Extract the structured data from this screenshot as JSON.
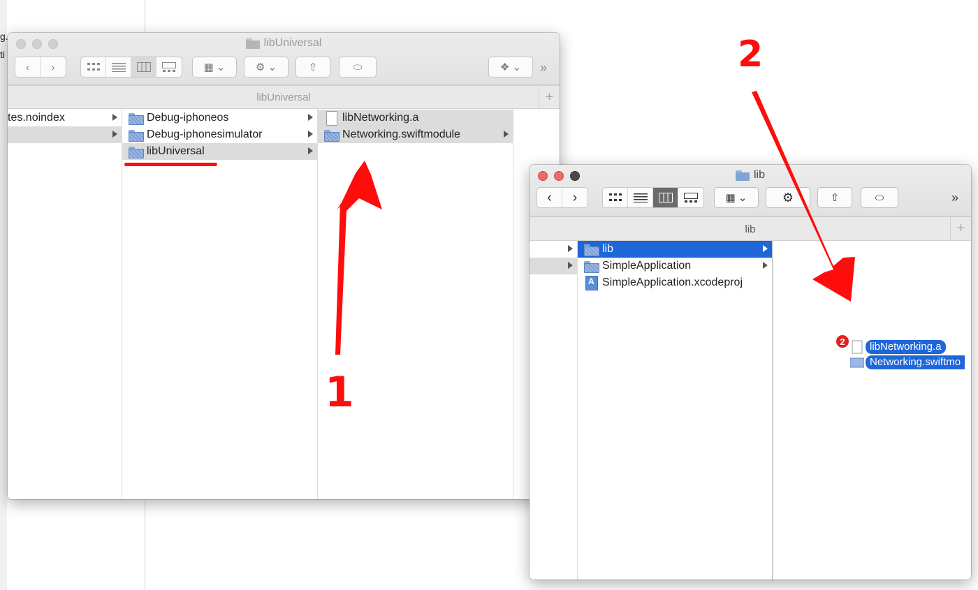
{
  "background_window": {
    "fragments": [
      "g.",
      "ti",
      "tes.noindex"
    ]
  },
  "window1": {
    "title": "libUniversal",
    "path_label": "libUniversal",
    "toolbar": {
      "back_glyph": "‹",
      "forward_glyph": "›",
      "view_icons": [
        "grid-view-icon",
        "list-view-icon",
        "column-view-icon",
        "gallery-view-icon"
      ],
      "group_glyph": "▦ ⌄",
      "action_glyph": "⚙ ⌄",
      "share_glyph": "⇧",
      "tag_glyph": "⬭",
      "dropbox_glyph": "❖ ⌄",
      "overflow_glyph": "»"
    },
    "col1": [
      {
        "label": "tes.noindex"
      },
      {
        "label": ""
      }
    ],
    "col2": [
      {
        "label": "Debug-iphoneos"
      },
      {
        "label": "Debug-iphonesimulator"
      },
      {
        "label": "libUniversal"
      }
    ],
    "col3": [
      {
        "label": "libNetworking.a"
      },
      {
        "label": "Networking.swiftmodule"
      }
    ]
  },
  "window2": {
    "title": "lib",
    "path_label": "lib",
    "toolbar": {
      "back_glyph": "‹",
      "forward_glyph": "›",
      "group_glyph": "▦ ⌄",
      "action_glyph": "⚙",
      "share_glyph": "⇧",
      "tag_glyph": "⬭",
      "overflow_glyph": "»"
    },
    "col2": [
      {
        "label": "lib"
      },
      {
        "label": "SimpleApplication"
      },
      {
        "label": "SimpleApplication.xcodeproj"
      }
    ]
  },
  "drag": {
    "count": "2",
    "items": [
      "libNetworking.a",
      "Networking.swiftmo"
    ]
  },
  "annotations": {
    "step1": "1",
    "step2": "2",
    "color": "#ff0d0d"
  },
  "colors": {
    "selection_blue": "#1f66d9",
    "selection_gray": "#dcdcdc"
  }
}
